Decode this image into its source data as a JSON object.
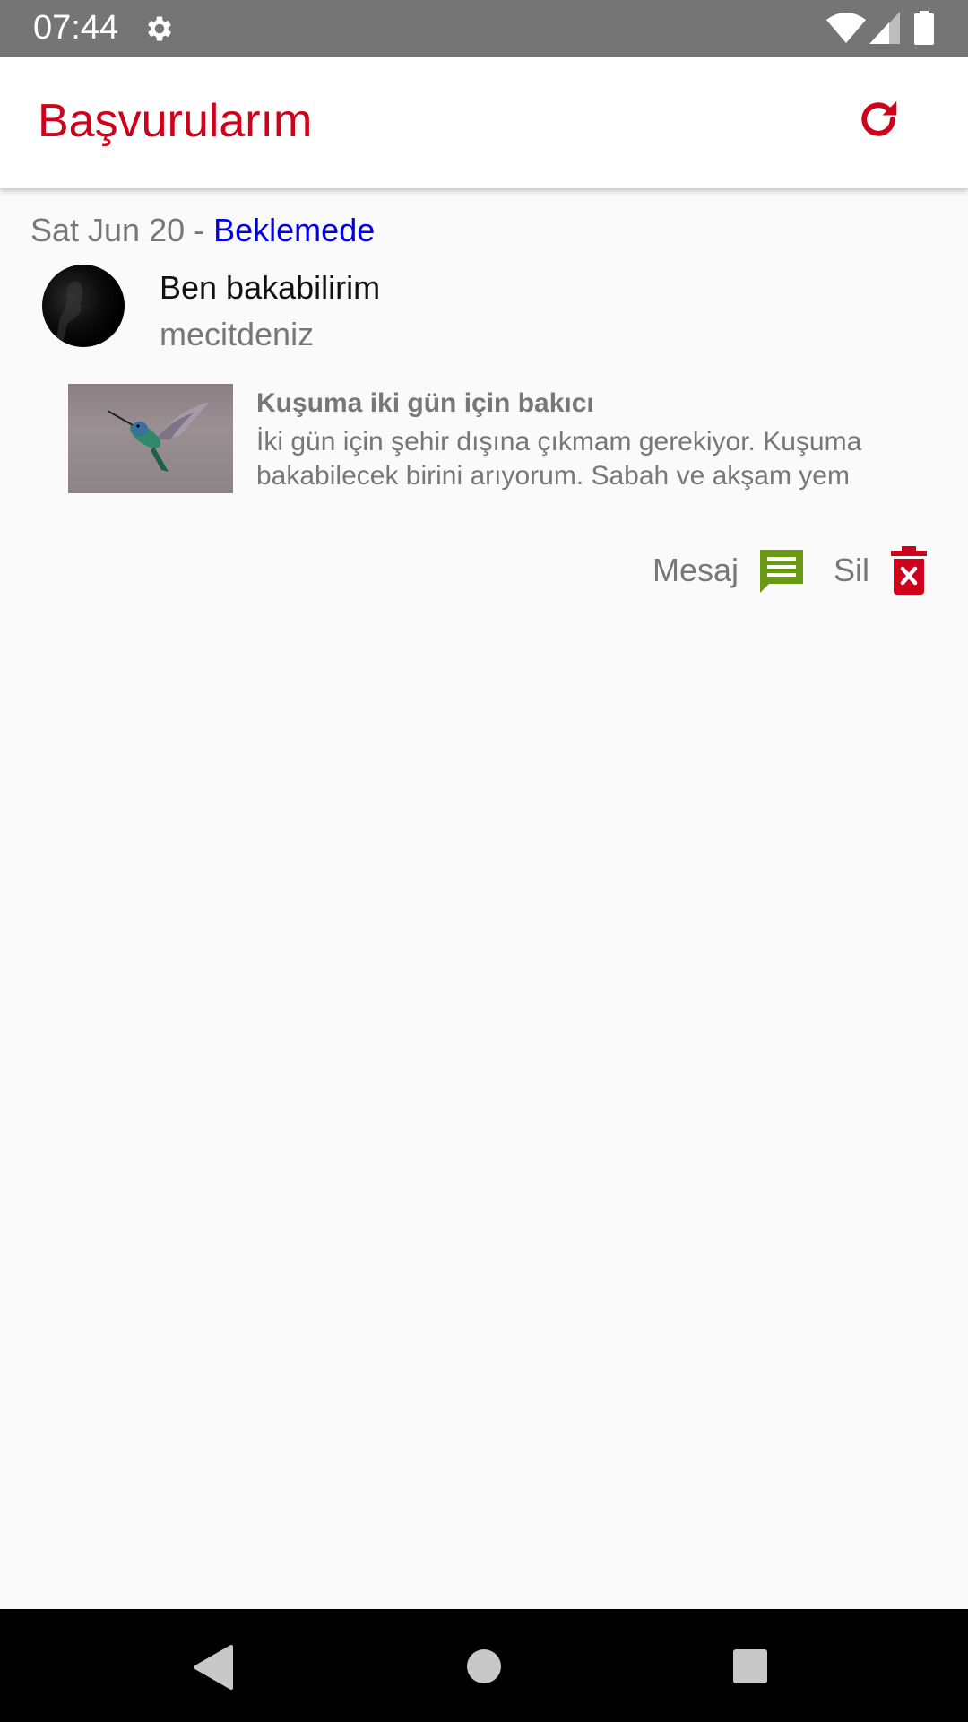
{
  "status_bar": {
    "time": "07:44",
    "icons": [
      "gear-icon",
      "wifi-icon",
      "signal-icon",
      "battery-icon"
    ]
  },
  "app_bar": {
    "title": "Başvurularım",
    "action_icon": "refresh-icon"
  },
  "application": {
    "date": "Sat Jun 20",
    "separator": " - ",
    "status": "Beklemede",
    "user": {
      "name": "Ben bakabilirim",
      "handle": "mecitdeniz"
    },
    "listing": {
      "title": "Kuşuma iki gün için bakıcı",
      "description": "İki gün için şehir dışına çıkmam gerekiyor. Kuşuma bakabilecek birini arıyorum. Sabah ve akşam yem"
    },
    "actions": {
      "message_label": "Mesaj",
      "delete_label": "Sil"
    }
  },
  "colors": {
    "accent_red": "#d0021b",
    "status_blue": "#0000e6",
    "message_green": "#6a9a14",
    "status_bar": "#757575"
  }
}
